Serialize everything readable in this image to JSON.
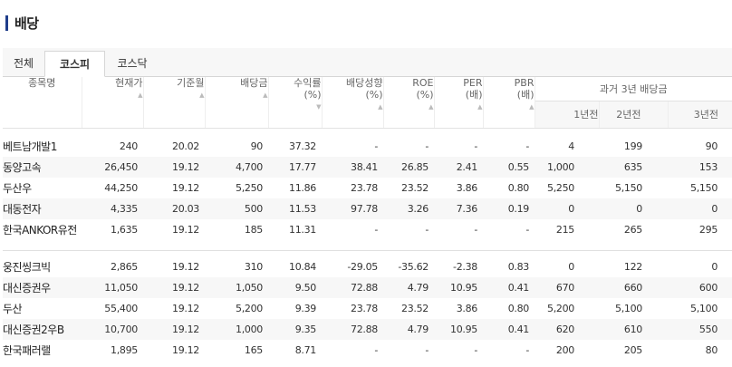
{
  "title": "배당",
  "tabs": [
    {
      "label": "전체",
      "active": false
    },
    {
      "label": "코스피",
      "active": true
    },
    {
      "label": "코스닥",
      "active": false
    }
  ],
  "headers": {
    "name": "종목명",
    "price": "현재가",
    "base_month": "기준월",
    "dividend": "배당금",
    "yield_line1": "수익률",
    "yield_line2": "(%)",
    "payout_line1": "배당성향",
    "payout_line2": "(%)",
    "roe_line1": "ROE",
    "roe_line2": "(%)",
    "per_line1": "PER",
    "per_line2": "(배)",
    "pbr_line1": "PBR",
    "pbr_line2": "(배)",
    "past_group": "과거 3년 배당금",
    "past_1y": "1년전",
    "past_2y": "2년전",
    "past_3y": "3년전"
  },
  "sort_icon": "triangle-up-icon",
  "group1": [
    {
      "name": "베트남개발1",
      "price": "240",
      "month": "20.02",
      "div": "90",
      "yield": "37.32",
      "payout": "-",
      "roe": "-",
      "per": "-",
      "pbr": "-",
      "y1": "4",
      "y2": "199",
      "y3": "90"
    },
    {
      "name": "동양고속",
      "price": "26,450",
      "month": "19.12",
      "div": "4,700",
      "yield": "17.77",
      "payout": "38.41",
      "roe": "26.85",
      "per": "2.41",
      "pbr": "0.55",
      "y1": "1,000",
      "y2": "635",
      "y3": "153"
    },
    {
      "name": "두산우",
      "price": "44,250",
      "month": "19.12",
      "div": "5,250",
      "yield": "11.86",
      "payout": "23.78",
      "roe": "23.52",
      "per": "3.86",
      "pbr": "0.80",
      "y1": "5,250",
      "y2": "5,150",
      "y3": "5,150"
    },
    {
      "name": "대동전자",
      "price": "4,335",
      "month": "20.03",
      "div": "500",
      "yield": "11.53",
      "payout": "97.78",
      "roe": "3.26",
      "per": "7.36",
      "pbr": "0.19",
      "y1": "0",
      "y2": "0",
      "y3": "0"
    },
    {
      "name": "한국ANKOR유전",
      "price": "1,635",
      "month": "19.12",
      "div": "185",
      "yield": "11.31",
      "payout": "-",
      "roe": "-",
      "per": "-",
      "pbr": "-",
      "y1": "215",
      "y2": "265",
      "y3": "295"
    }
  ],
  "group2": [
    {
      "name": "웅진씽크빅",
      "price": "2,865",
      "month": "19.12",
      "div": "310",
      "yield": "10.84",
      "payout": "-29.05",
      "roe": "-35.62",
      "per": "-2.38",
      "pbr": "0.83",
      "y1": "0",
      "y2": "122",
      "y3": "0"
    },
    {
      "name": "대신증권우",
      "price": "11,050",
      "month": "19.12",
      "div": "1,050",
      "yield": "9.50",
      "payout": "72.88",
      "roe": "4.79",
      "per": "10.95",
      "pbr": "0.41",
      "y1": "670",
      "y2": "660",
      "y3": "600"
    },
    {
      "name": "두산",
      "price": "55,400",
      "month": "19.12",
      "div": "5,200",
      "yield": "9.39",
      "payout": "23.78",
      "roe": "23.52",
      "per": "3.86",
      "pbr": "0.80",
      "y1": "5,200",
      "y2": "5,100",
      "y3": "5,100"
    },
    {
      "name": "대신증권2우B",
      "price": "10,700",
      "month": "19.12",
      "div": "1,000",
      "yield": "9.35",
      "payout": "72.88",
      "roe": "4.79",
      "per": "10.95",
      "pbr": "0.41",
      "y1": "620",
      "y2": "610",
      "y3": "550"
    },
    {
      "name": "한국패러랠",
      "price": "1,895",
      "month": "19.12",
      "div": "165",
      "yield": "8.71",
      "payout": "-",
      "roe": "-",
      "per": "-",
      "pbr": "-",
      "y1": "200",
      "y2": "205",
      "y3": "80"
    }
  ]
}
